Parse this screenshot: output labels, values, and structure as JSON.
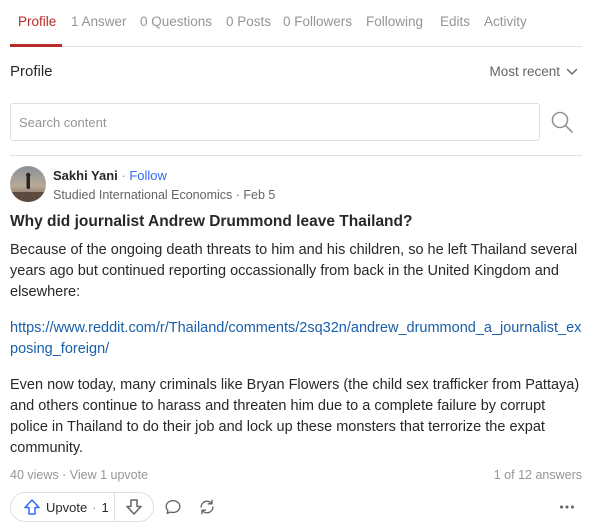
{
  "tabs": [
    {
      "label": "Profile"
    },
    {
      "label": "1 Answer"
    },
    {
      "label": "0 Questions"
    },
    {
      "label": "0 Posts"
    },
    {
      "label": "0 Followers"
    },
    {
      "label": "Following"
    },
    {
      "label": "Edits"
    },
    {
      "label": "Activity"
    }
  ],
  "section": {
    "title": "Profile",
    "sort_label": "Most recent"
  },
  "search": {
    "placeholder": "Search content",
    "value": ""
  },
  "answer": {
    "author_name": "Sakhi Yani",
    "separator": " · ",
    "follow_label": "Follow",
    "credential": "Studied International Economics",
    "date": "Feb 5",
    "question": "Why did journalist Andrew Drummond leave Thailand?",
    "paragraph1": "Because of the ongoing death threats to him and his children, so he left Thailand several years ago but continued reporting occassionally from back in the United Kingdom and elsewhere:",
    "link": "https://www.reddit.com/r/Thailand/comments/2sq32n/andrew_drummond_a_journalist_exposing_foreign/",
    "paragraph3": "Even now today, many criminals like Bryan Flowers (the child sex trafficker from Pattaya) and others continue to harass and threaten him due to a complete failure by corrupt police in Thailand to do their job and lock up these monsters that terrorize the expat community.",
    "views": "40 views",
    "upvote_view": "View 1 upvote",
    "answer_count": "1 of 12 answers",
    "upvote_label": "Upvote",
    "upvote_count": "1"
  },
  "colors": {
    "accent": "#b92b27",
    "link": "#195faa",
    "follow": "#2e69ff",
    "upvote": "#2e69ff"
  }
}
